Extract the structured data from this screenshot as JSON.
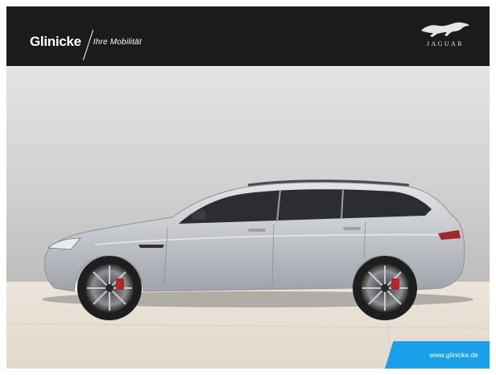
{
  "header": {
    "brand_name": "Glinicke",
    "tagline": "Ihre Mobilität",
    "manufacturer_logo_text": "JAGUAR",
    "manufacturer_logo_icon": "leaping-jaguar-icon"
  },
  "photo": {
    "subject": "silver-station-wagon",
    "footer_url": "www.glinicke.de"
  },
  "colors": {
    "header_bg": "#1b1b1b",
    "badge_bg": "#1aa0e8",
    "car_body": "#c9ccd0"
  }
}
